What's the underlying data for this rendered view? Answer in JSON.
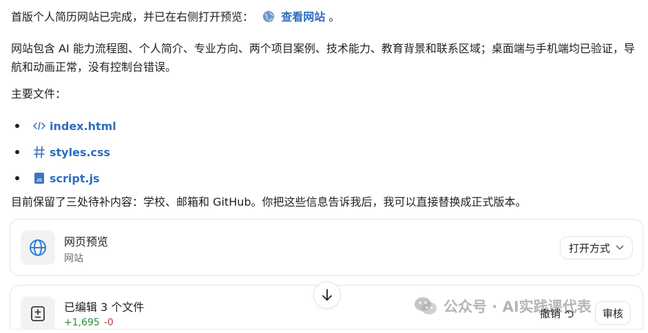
{
  "message": {
    "intro_text": "首版个人简历网站已完成，并已在右侧打开预览：",
    "intro_link": "查看网站",
    "intro_end": "。",
    "description": "网站包含 AI 能力流程图、个人简介、专业方向、两个项目案例、技术能力、教育背景和联系区域；桌面端与手机端均已验证，导航和动画正常，没有控制台错误。",
    "files_heading": "主要文件：",
    "files": [
      {
        "name": "index.html",
        "icon": "code-icon"
      },
      {
        "name": "styles.css",
        "icon": "hash-icon"
      },
      {
        "name": "script.js",
        "icon": "js-file-icon"
      }
    ],
    "footer": "目前保留了三处待补内容：学校、邮箱和 GitHub。你把这些信息告诉我后，我可以直接替换成正式版本。"
  },
  "preview_card": {
    "title": "网页预览",
    "subtitle": "网站",
    "open_button": "打开方式"
  },
  "edit_card": {
    "title": "已编辑 3 个文件",
    "additions": "+1,695",
    "deletions": "-0",
    "undo_button": "撤销",
    "review_button": "审核"
  },
  "watermark": {
    "text": "公众号 · AI实践课代表"
  },
  "colors": {
    "link": "#2e6dbf",
    "additions": "#2e8a3e",
    "deletions": "#d0353c"
  }
}
